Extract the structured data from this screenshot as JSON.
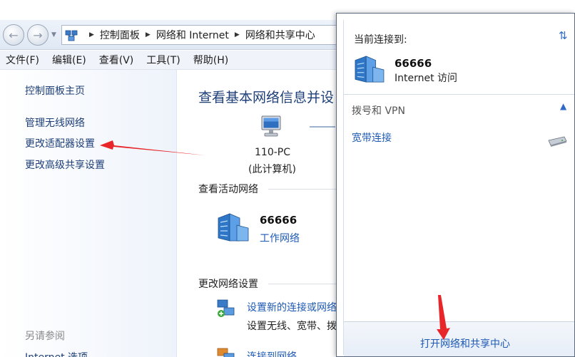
{
  "window": {
    "breadcrumb": [
      "控制面板",
      "网络和 Internet",
      "网络和共享中心"
    ]
  },
  "menu": [
    "文件(F)",
    "编辑(E)",
    "查看(V)",
    "工具(T)",
    "帮助(H)"
  ],
  "sidebar": {
    "home": "控制面板主页",
    "items": [
      "管理无线网络",
      "更改适配器设置",
      "更改高级共享设置"
    ],
    "see_also_heading": "另请参阅",
    "see_also_items": [
      "Internet 选项"
    ]
  },
  "main": {
    "title": "查看基本网络信息并设",
    "computer_name": "110-PC",
    "computer_subtitle": "(此计算机)",
    "active_networks_heading": "查看活动网络",
    "network_name": "66666",
    "network_type": "工作网络",
    "change_settings_heading": "更改网络设置",
    "tasks": [
      {
        "link": "设置新的连接或网络",
        "desc": "设置无线、宽带、拨"
      },
      {
        "link": "连接到网络",
        "desc": ""
      }
    ]
  },
  "flyout": {
    "connected_to_label": "当前连接到:",
    "network_name": "66666",
    "access": "Internet 访问",
    "vpn_heading": "拨号和 VPN",
    "dialup_item": "宽带连接",
    "open_center_link": "打开网络和共享中心"
  },
  "colors": {
    "link": "#1e5ab4",
    "title": "#1e3f78",
    "annotation_arrow": "#e8262a"
  },
  "icons": [
    "back-arrow-icon",
    "forward-arrow-icon",
    "network-folder-icon",
    "computer-icon",
    "building-network-icon",
    "new-connection-icon",
    "refresh-icon",
    "chevron-up-icon",
    "modem-icon"
  ]
}
